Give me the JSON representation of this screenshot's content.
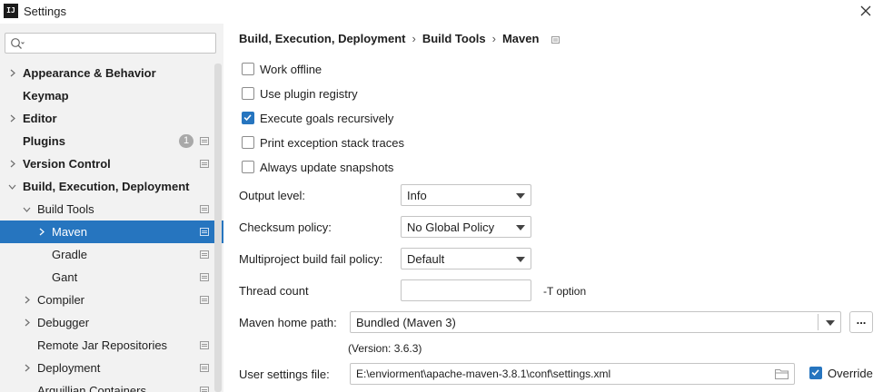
{
  "window": {
    "title": "Settings",
    "app_icon": "IJ"
  },
  "search": {
    "placeholder": "",
    "value": ""
  },
  "sidebar": {
    "items": [
      {
        "label": "Appearance & Behavior",
        "level": 0,
        "bold": true,
        "chevron": "right"
      },
      {
        "label": "Keymap",
        "level": 0,
        "bold": true,
        "chevron": "none"
      },
      {
        "label": "Editor",
        "level": 0,
        "bold": true,
        "chevron": "right"
      },
      {
        "label": "Plugins",
        "level": 0,
        "bold": true,
        "chevron": "none",
        "badge": "1",
        "project_icon": true
      },
      {
        "label": "Version Control",
        "level": 0,
        "bold": true,
        "chevron": "right",
        "project_icon": true
      },
      {
        "label": "Build, Execution, Deployment",
        "level": 0,
        "bold": true,
        "chevron": "down"
      },
      {
        "label": "Build Tools",
        "level": 1,
        "bold": false,
        "chevron": "down",
        "project_icon": true
      },
      {
        "label": "Maven",
        "level": 2,
        "bold": false,
        "chevron": "right",
        "project_icon": true,
        "selected": true
      },
      {
        "label": "Gradle",
        "level": 2,
        "bold": false,
        "chevron": "none",
        "project_icon": true
      },
      {
        "label": "Gant",
        "level": 2,
        "bold": false,
        "chevron": "none",
        "project_icon": true
      },
      {
        "label": "Compiler",
        "level": 1,
        "bold": false,
        "chevron": "right",
        "project_icon": true
      },
      {
        "label": "Debugger",
        "level": 1,
        "bold": false,
        "chevron": "right"
      },
      {
        "label": "Remote Jar Repositories",
        "level": 1,
        "bold": false,
        "chevron": "none",
        "project_icon": true
      },
      {
        "label": "Deployment",
        "level": 1,
        "bold": false,
        "chevron": "right",
        "project_icon": true
      },
      {
        "label": "Arquillian Containers",
        "level": 1,
        "bold": false,
        "chevron": "none",
        "project_icon": true
      }
    ]
  },
  "breadcrumb": {
    "part1": "Build, Execution, Deployment",
    "part2": "Build Tools",
    "part3": "Maven",
    "sep": "›"
  },
  "options": {
    "work_offline": {
      "label": "Work offline",
      "checked": false
    },
    "use_plugin_registry": {
      "label": "Use plugin registry",
      "checked": false
    },
    "execute_goals_recursively": {
      "label": "Execute goals recursively",
      "checked": true
    },
    "print_exception_stack_traces": {
      "label": "Print exception stack traces",
      "checked": false
    },
    "always_update_snapshots": {
      "label": "Always update snapshots",
      "checked": false
    }
  },
  "form": {
    "output_level": {
      "label": "Output level:",
      "value": "Info"
    },
    "checksum_policy": {
      "label": "Checksum policy:",
      "value": "No Global Policy"
    },
    "multiproject_fail_policy": {
      "label": "Multiproject build fail policy:",
      "value": "Default"
    },
    "thread_count": {
      "label": "Thread count",
      "value": "",
      "hint": "-T option"
    },
    "maven_home": {
      "label": "Maven home path:",
      "value": "Bundled (Maven 3)",
      "browse": "...",
      "version": "(Version: 3.6.3)"
    },
    "user_settings": {
      "label": "User settings file:",
      "value": "E:\\enviorment\\apache-maven-3.8.1\\conf\\settings.xml",
      "override_label": "Override",
      "override_checked": true
    }
  },
  "colors": {
    "accent": "#2675bf",
    "sidebar_bg": "#f2f2f2",
    "badge_bg": "#a9a9a9"
  }
}
